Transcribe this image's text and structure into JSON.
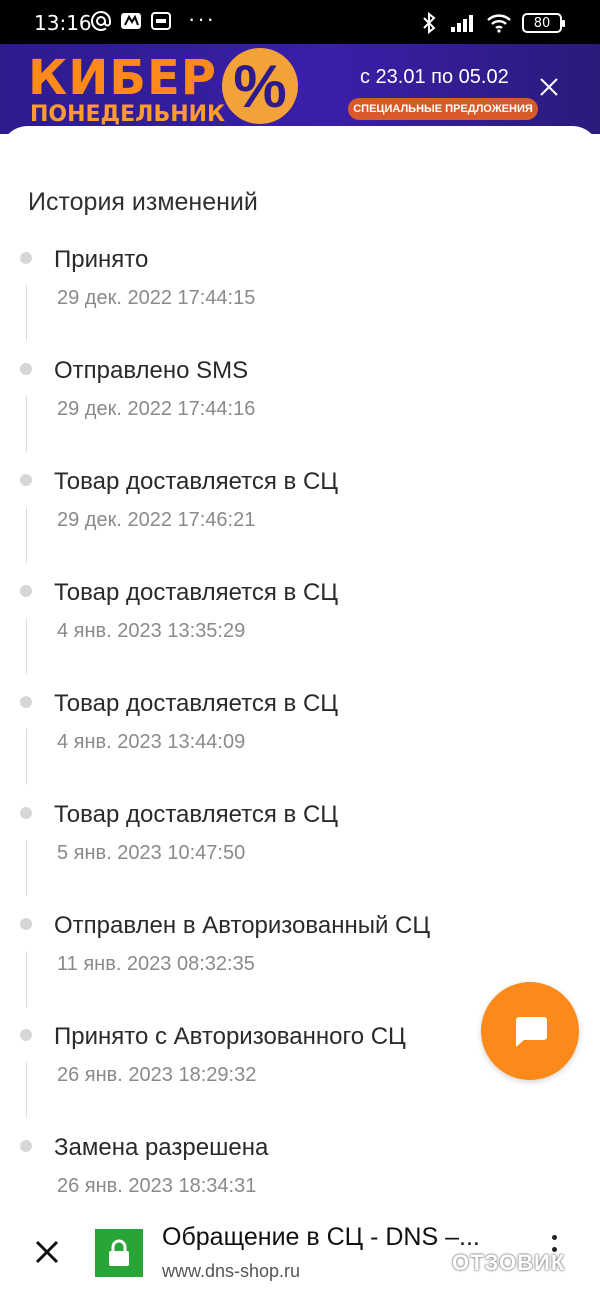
{
  "status_bar": {
    "time": "13:16",
    "battery": "80",
    "icons": [
      "at-icon",
      "app-icon",
      "photo-icon",
      "more-dots-icon",
      "bluetooth-icon",
      "signal-icon",
      "wifi-icon",
      "battery-icon"
    ]
  },
  "banner": {
    "line1": "КИБЕР",
    "line2": "ПОНЕДЕЛЬНИК",
    "percent": "%",
    "dates": "с 23.01 по 05.02",
    "special": "СПЕЦИАЛЬНЫЕ ПРЕДЛОЖЕНИЯ"
  },
  "history": {
    "title": "История изменений",
    "events": [
      {
        "title": "Принято",
        "date": "29 дек. 2022 17:44:15"
      },
      {
        "title": "Отправлено SMS",
        "date": "29 дек. 2022 17:44:16"
      },
      {
        "title": "Товар доставляется в СЦ",
        "date": "29 дек. 2022 17:46:21"
      },
      {
        "title": "Товар доставляется в СЦ",
        "date": "4 янв. 2023 13:35:29"
      },
      {
        "title": "Товар доставляется в СЦ",
        "date": "4 янв. 2023 13:44:09"
      },
      {
        "title": "Товар доставляется в СЦ",
        "date": "5 янв. 2023 10:47:50"
      },
      {
        "title": "Отправлен в Авторизованный СЦ",
        "date": "11 янв. 2023 08:32:35"
      },
      {
        "title": "Принято с Авторизованного СЦ",
        "date": "26 янв. 2023 18:29:32"
      },
      {
        "title": "Замена разрешена",
        "date": "26 янв. 2023 18:34:31"
      }
    ]
  },
  "url_bar": {
    "page_title": "Обращение в СЦ - DNS –...",
    "host": "www.dns-shop.ru"
  },
  "watermark": "ОТЗОВИК",
  "colors": {
    "accent": "#fb8a1a",
    "lock": "#27a537",
    "banner_bg": "#2d1b8e"
  }
}
